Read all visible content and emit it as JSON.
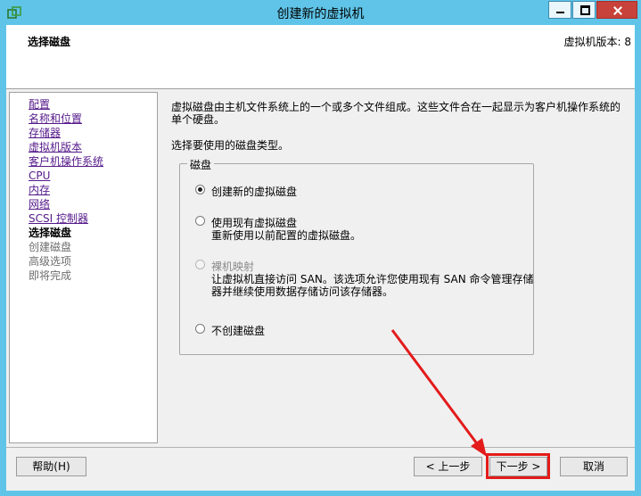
{
  "window": {
    "title": "创建新的虚拟机",
    "minimize_icon": "minimize-icon",
    "maximize_icon": "maximize-icon",
    "close_icon": "close-icon"
  },
  "header": {
    "title": "选择磁盘",
    "version": "虚拟机版本: 8"
  },
  "nav": {
    "items": [
      {
        "label": "配置",
        "state": "link"
      },
      {
        "label": "名称和位置",
        "state": "link"
      },
      {
        "label": "存储器",
        "state": "link"
      },
      {
        "label": "虚拟机版本",
        "state": "link"
      },
      {
        "label": "客户机操作系统",
        "state": "link"
      },
      {
        "label": "CPU",
        "state": "link"
      },
      {
        "label": "内存",
        "state": "link"
      },
      {
        "label": "网络",
        "state": "link"
      },
      {
        "label": "SCSI 控制器",
        "state": "link"
      },
      {
        "label": "选择磁盘",
        "state": "current"
      },
      {
        "label": "创建磁盘",
        "state": "future"
      },
      {
        "label": "高级选项",
        "state": "future"
      },
      {
        "label": "即将完成",
        "state": "future"
      }
    ]
  },
  "main": {
    "description": "虚拟磁盘由主机文件系统上的一个或多个文件组成。这些文件合在一起显示为客户机操作系统的单个硬盘。",
    "prompt": "选择要使用的磁盘类型。",
    "group_label": "磁盘",
    "options": [
      {
        "label": "创建新的虚拟磁盘",
        "checked": true,
        "disabled": false,
        "description": ""
      },
      {
        "label": "使用现有虚拟磁盘",
        "checked": false,
        "disabled": false,
        "description": "重新使用以前配置的虚拟磁盘。"
      },
      {
        "label": "裸机映射",
        "checked": false,
        "disabled": true,
        "description": "让虚拟机直接访问 SAN。该选项允许您使用现有 SAN 命令管理存储器并继续使用数据存储访问该存储器。"
      },
      {
        "label": "不创建磁盘",
        "checked": false,
        "disabled": false,
        "description": ""
      }
    ]
  },
  "footer": {
    "help_label": "帮助(H)",
    "back_label": "< 上一步",
    "next_label": "下一步 >",
    "cancel_label": "取消"
  },
  "annotation": {
    "color": "#e31b1b"
  }
}
